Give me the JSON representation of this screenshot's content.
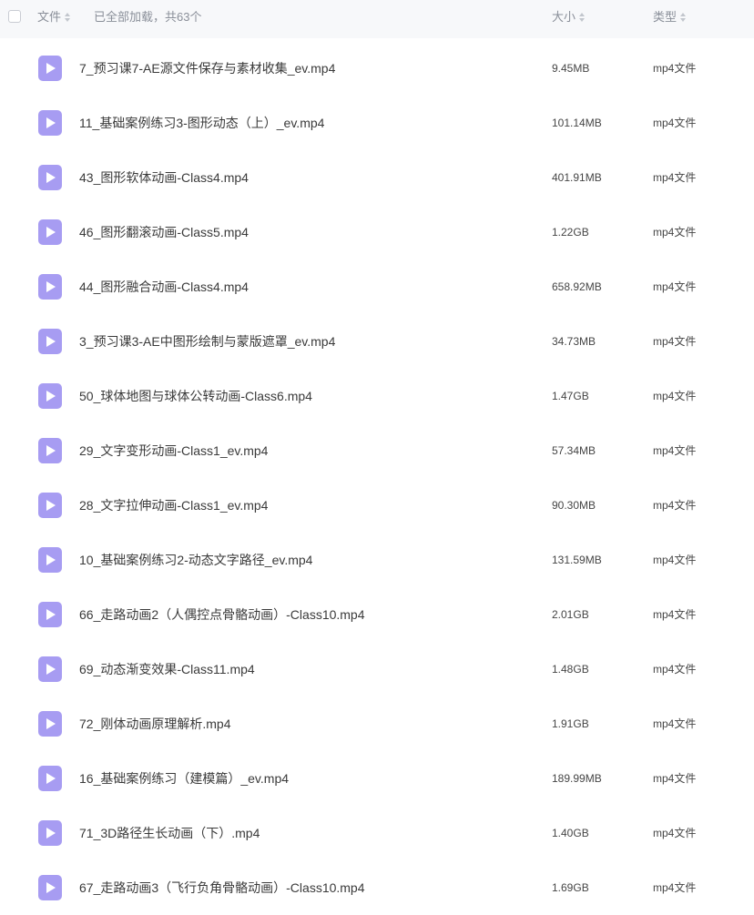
{
  "header": {
    "col_file": "文件",
    "status": "已全部加载，共63个",
    "col_size": "大小",
    "col_type": "类型"
  },
  "colors": {
    "video_icon": "#a79cf2",
    "header_bg": "#f7f8fa"
  },
  "files": [
    {
      "name": "7_预习课7-AE源文件保存与素材收集_ev.mp4",
      "size": "9.45MB",
      "type": "mp4文件",
      "icon": "video-file-icon"
    },
    {
      "name": "11_基础案例练习3-图形动态（上）_ev.mp4",
      "size": "101.14MB",
      "type": "mp4文件",
      "icon": "video-file-icon"
    },
    {
      "name": "43_图形软体动画-Class4.mp4",
      "size": "401.91MB",
      "type": "mp4文件",
      "icon": "video-file-icon"
    },
    {
      "name": "46_图形翻滚动画-Class5.mp4",
      "size": "1.22GB",
      "type": "mp4文件",
      "icon": "video-file-icon"
    },
    {
      "name": "44_图形融合动画-Class4.mp4",
      "size": "658.92MB",
      "type": "mp4文件",
      "icon": "video-file-icon"
    },
    {
      "name": "3_预习课3-AE中图形绘制与蒙版遮罩_ev.mp4",
      "size": "34.73MB",
      "type": "mp4文件",
      "icon": "video-file-icon"
    },
    {
      "name": "50_球体地图与球体公转动画-Class6.mp4",
      "size": "1.47GB",
      "type": "mp4文件",
      "icon": "video-file-icon"
    },
    {
      "name": "29_文字变形动画-Class1_ev.mp4",
      "size": "57.34MB",
      "type": "mp4文件",
      "icon": "video-file-icon"
    },
    {
      "name": "28_文字拉伸动画-Class1_ev.mp4",
      "size": "90.30MB",
      "type": "mp4文件",
      "icon": "video-file-icon"
    },
    {
      "name": "10_基础案例练习2-动态文字路径_ev.mp4",
      "size": "131.59MB",
      "type": "mp4文件",
      "icon": "video-file-icon"
    },
    {
      "name": "66_走路动画2（人偶控点骨骼动画）-Class10.mp4",
      "size": "2.01GB",
      "type": "mp4文件",
      "icon": "video-file-icon"
    },
    {
      "name": "69_动态渐变效果-Class11.mp4",
      "size": "1.48GB",
      "type": "mp4文件",
      "icon": "video-file-icon"
    },
    {
      "name": "72_刚体动画原理解析.mp4",
      "size": "1.91GB",
      "type": "mp4文件",
      "icon": "video-file-icon"
    },
    {
      "name": "16_基础案例练习（建模篇）_ev.mp4",
      "size": "189.99MB",
      "type": "mp4文件",
      "icon": "video-file-icon"
    },
    {
      "name": "71_3D路径生长动画（下）.mp4",
      "size": "1.40GB",
      "type": "mp4文件",
      "icon": "video-file-icon"
    },
    {
      "name": "67_走路动画3（飞行负角骨骼动画）-Class10.mp4",
      "size": "1.69GB",
      "type": "mp4文件",
      "icon": "video-file-icon"
    }
  ]
}
